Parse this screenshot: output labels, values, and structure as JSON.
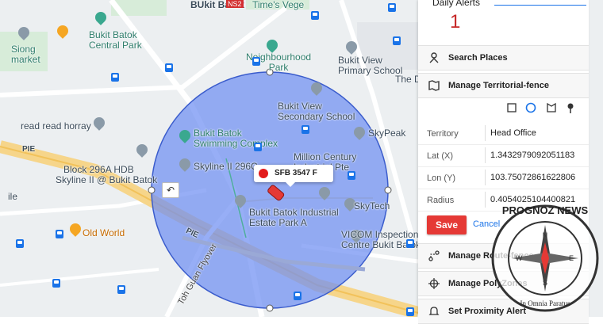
{
  "map": {
    "labels": {
      "bukit_batok_top": "BUkit Batok",
      "ns2": "NS2",
      "time_vege": "Time's Vege",
      "siong_market": "Siong\nmarket",
      "central_park": "Bukit Batok\nCentral Park",
      "neighbourhood_park": "Neighbourhood\nPark",
      "view_primary": "Bukit View\nPrimary School",
      "the_d": "The D",
      "view_secondary": "Bukit View\nSecondary School",
      "read_read": "read read horray",
      "swimming": "Bukit Batok\nSwimming Complex",
      "skypeak": "SkyPeak",
      "pie_left": "PIE",
      "block296": "Block 296A HDB",
      "skyline_at": "Skyline II @ Bukit Batok",
      "skyline_296c": "Skyline II 296C",
      "million_century": "Million Century\nIndustrial Pte",
      "ile": "ile",
      "industrial_estate": "Bukit Batok Industrial\nEstate Park A",
      "skytech": "SkyTech",
      "old_world": "Old World",
      "pie_mid": "PIE",
      "toh_guan": "Toh Guan Flyover",
      "vicom": "VICOM Inspection\nCentre Bukit Batok"
    },
    "vehicle_label": "SFB 3547 F",
    "undo_icon": "undo-icon",
    "colors": {
      "fence_fill": "#6f8ff2",
      "fence_stroke": "#3a5ccc",
      "accent": "#e53935"
    }
  },
  "panel": {
    "daily_alerts": {
      "title": "Daily Alerts",
      "count": "1"
    },
    "search_places": "Search Places",
    "manage_territorial_fence": "Manage Territorial-fence",
    "tools": [
      "rectangle-tool-icon",
      "circle-tool-icon",
      "polygon-tool-icon",
      "pin-tool-icon"
    ],
    "form": {
      "territory_label": "Territory",
      "territory_value": "Head Office",
      "lat_label": "Lat (X)",
      "lat_value": "1.3432979092051183",
      "lon_label": "Lon (Y)",
      "lon_value": "103.75072861622806",
      "radius_label": "Radius",
      "radius_value": "0.4054025104400821"
    },
    "save_label": "Save",
    "cancel_label": "Cancel",
    "manage_route_fence": "Manage Route-fence",
    "manage_poly_zones": "Manage PolyZones",
    "set_proximity_alert": "Set Proximity Alert"
  },
  "watermark": {
    "brand": "PROGNOZ NEWS",
    "motto": "In Omnia Paratus",
    "letters": {
      "n": "N",
      "s": "S",
      "e": "E",
      "w": "W"
    }
  }
}
